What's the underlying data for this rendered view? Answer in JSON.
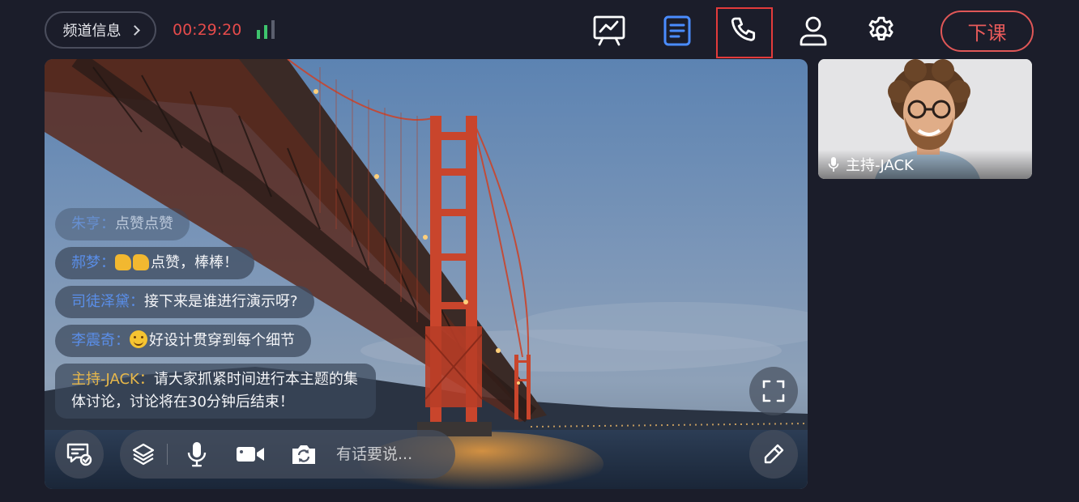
{
  "header": {
    "channel_info_label": "频道信息",
    "timer": "00:29:20",
    "end_class_label": "下课",
    "icons": [
      "whiteboard-icon",
      "document-icon",
      "phone-icon",
      "user-icon",
      "gear-icon"
    ]
  },
  "chat": {
    "messages": [
      {
        "name": "朱亨：",
        "text": "点赞点赞"
      },
      {
        "name": "郝梦：",
        "text": "点赞，棒棒！"
      },
      {
        "name": "司徒泽黛：",
        "text": "接下来是谁进行演示呀?"
      },
      {
        "name": "李震奇：",
        "text": "好设计贯穿到每个细节"
      },
      {
        "name": "主持-JACK：",
        "text": "请大家抓紧时间进行本主题的集体讨论，讨论将在30分钟后结束！"
      }
    ]
  },
  "toolbar": {
    "input_placeholder": "有话要说..."
  },
  "host": {
    "label": "主持-JACK"
  },
  "colors": {
    "background": "#1b1d2a",
    "accent_red": "#e05757",
    "accent_blue": "#4a8cff",
    "signal_green": "#3ec46d"
  }
}
